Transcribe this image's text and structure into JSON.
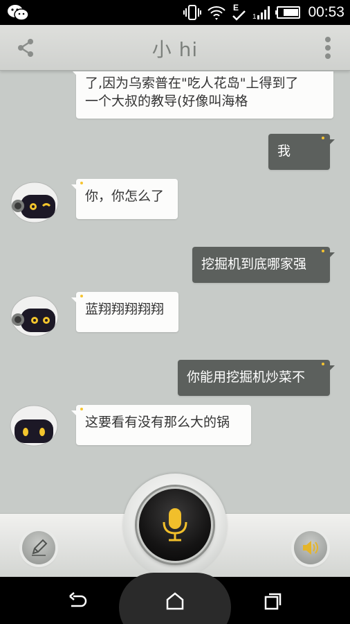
{
  "status_bar": {
    "time": "00:53",
    "icons": [
      "wechat-notification-icon",
      "vibrate-icon",
      "wifi-icon",
      "data-e-icon",
      "signal-icon",
      "battery-icon"
    ]
  },
  "title_bar": {
    "title": "小 hi",
    "left_icon": "share-icon",
    "right_icon": "more-vert-icon"
  },
  "messages": [
    {
      "sender": "bot",
      "lines": [
        "了,因为乌索普在\"吃人花岛\"上得到了",
        "一个大叔的教导(好像叫海格"
      ]
    },
    {
      "sender": "user",
      "text": "我"
    },
    {
      "sender": "bot",
      "text": "你，你怎么了"
    },
    {
      "sender": "user",
      "text": "挖掘机到底哪家强"
    },
    {
      "sender": "bot",
      "text": "蓝翔翔翔翔翔"
    },
    {
      "sender": "user",
      "text": "你能用挖掘机炒菜不"
    },
    {
      "sender": "bot",
      "text": "这要看有没有那么大的锅"
    }
  ],
  "input_bar": {
    "left_icon": "pencil-icon",
    "center_icon": "microphone-icon",
    "right_icon": "speaker-icon"
  },
  "nav_bar": {
    "icons": [
      "back-icon",
      "home-icon",
      "recent-apps-icon"
    ]
  },
  "colors": {
    "chat_background": "#c7cbc8",
    "bot_bubble": "#fcfcfb",
    "user_bubble": "#5c605d",
    "accent_yellow": "#f5c431"
  }
}
